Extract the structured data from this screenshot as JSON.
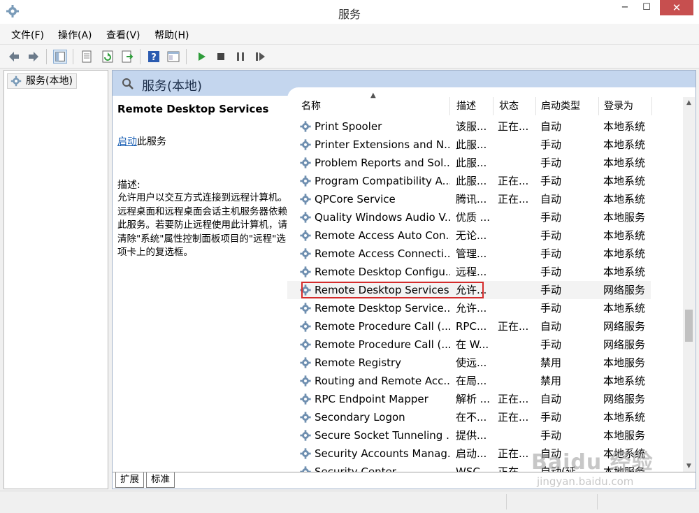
{
  "window": {
    "title": "服务",
    "minimize": "−",
    "maximize": "☐",
    "close": "✕"
  },
  "menu": [
    "文件(F)",
    "操作(A)",
    "查看(V)",
    "帮助(H)"
  ],
  "toolbar": [
    "back-icon",
    "forward-icon",
    "show-hide-tree-icon",
    "properties-icon",
    "refresh-icon",
    "export-icon",
    "help-icon",
    "console-view-icon",
    "start-service-icon",
    "stop-service-icon",
    "pause-service-icon",
    "restart-service-icon"
  ],
  "tree": {
    "root_label": "服务(本地)"
  },
  "main": {
    "header_title": "服务(本地)",
    "selected_service_name": "Remote Desktop Services",
    "start_link": "启动",
    "start_suffix": "此服务",
    "desc_label": "描述:",
    "desc_text": "允许用户以交互方式连接到远程计算机。远程桌面和远程桌面会话主机服务器依赖此服务。若要防止远程使用此计算机，请清除\"系统\"属性控制面板项目的\"远程\"选项卡上的复选框。"
  },
  "columns": {
    "name": "名称",
    "desc": "描述",
    "status": "状态",
    "startup": "启动类型",
    "logon": "登录为"
  },
  "services": [
    {
      "name": "Print Spooler",
      "desc": "该服...",
      "status": "正在...",
      "startup": "自动",
      "logon": "本地系统"
    },
    {
      "name": "Printer Extensions and N...",
      "desc": "此服...",
      "status": "",
      "startup": "手动",
      "logon": "本地系统"
    },
    {
      "name": "Problem Reports and Sol...",
      "desc": "此服...",
      "status": "",
      "startup": "手动",
      "logon": "本地系统"
    },
    {
      "name": "Program Compatibility A...",
      "desc": "此服...",
      "status": "正在...",
      "startup": "手动",
      "logon": "本地系统"
    },
    {
      "name": "QPCore Service",
      "desc": "腾讯...",
      "status": "正在...",
      "startup": "自动",
      "logon": "本地系统"
    },
    {
      "name": "Quality Windows Audio V...",
      "desc": "优质 ...",
      "status": "",
      "startup": "手动",
      "logon": "本地服务"
    },
    {
      "name": "Remote Access Auto Con...",
      "desc": "无论...",
      "status": "",
      "startup": "手动",
      "logon": "本地系统"
    },
    {
      "name": "Remote Access Connecti...",
      "desc": "管理...",
      "status": "",
      "startup": "手动",
      "logon": "本地系统"
    },
    {
      "name": "Remote Desktop Configu...",
      "desc": "远程...",
      "status": "",
      "startup": "手动",
      "logon": "本地系统"
    },
    {
      "name": "Remote Desktop Services",
      "desc": "允许...",
      "status": "",
      "startup": "手动",
      "logon": "网络服务"
    },
    {
      "name": "Remote Desktop Service...",
      "desc": "允许...",
      "status": "",
      "startup": "手动",
      "logon": "本地系统"
    },
    {
      "name": "Remote Procedure Call (...",
      "desc": "RPC...",
      "status": "正在...",
      "startup": "自动",
      "logon": "网络服务"
    },
    {
      "name": "Remote Procedure Call (...",
      "desc": "在 W...",
      "status": "",
      "startup": "手动",
      "logon": "网络服务"
    },
    {
      "name": "Remote Registry",
      "desc": "使远...",
      "status": "",
      "startup": "禁用",
      "logon": "本地服务"
    },
    {
      "name": "Routing and Remote Acc...",
      "desc": "在局...",
      "status": "",
      "startup": "禁用",
      "logon": "本地系统"
    },
    {
      "name": "RPC Endpoint Mapper",
      "desc": "解析 ...",
      "status": "正在...",
      "startup": "自动",
      "logon": "网络服务"
    },
    {
      "name": "Secondary Logon",
      "desc": "在不...",
      "status": "正在...",
      "startup": "手动",
      "logon": "本地系统"
    },
    {
      "name": "Secure Socket Tunneling ...",
      "desc": "提供...",
      "status": "",
      "startup": "手动",
      "logon": "本地服务"
    },
    {
      "name": "Security Accounts Manag...",
      "desc": "启动...",
      "status": "正在...",
      "startup": "自动",
      "logon": "本地系统"
    },
    {
      "name": "Security Center",
      "desc": "WSC...",
      "status": "正在...",
      "startup": "自动(延...",
      "logon": "本地服务"
    }
  ],
  "selected_index": 9,
  "tabs": [
    "扩展",
    "标准"
  ],
  "watermark": {
    "brand": "Baidu 经验",
    "url": "jingyan.baidu.com"
  },
  "colors": {
    "header_bg": "#c4d6ee",
    "highlight_border": "#d52b2b",
    "close_button": "#c74f4f",
    "link": "#1a5fb4"
  }
}
